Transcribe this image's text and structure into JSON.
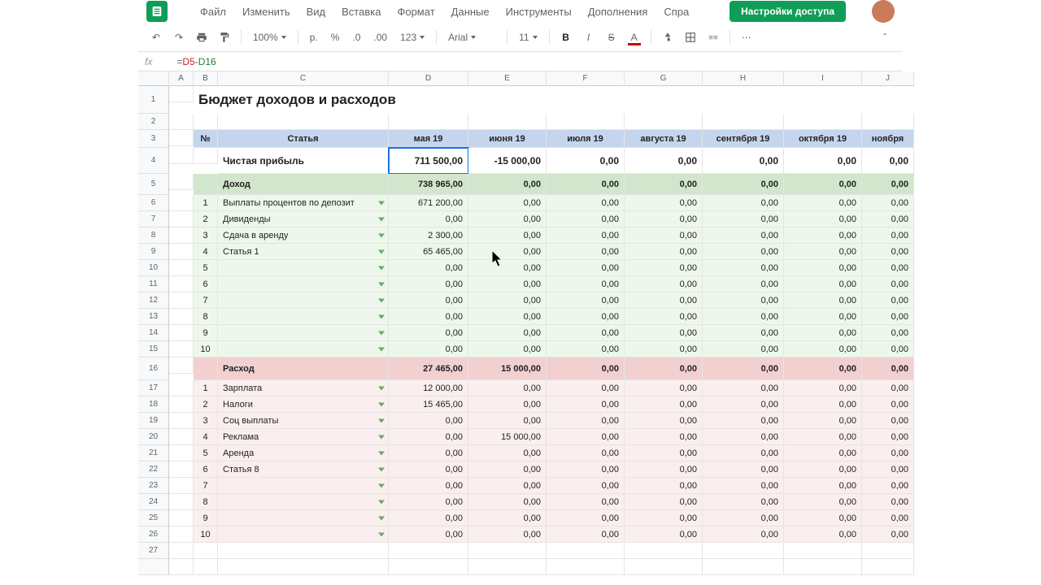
{
  "menubar": {
    "items": [
      "Файл",
      "Изменить",
      "Вид",
      "Вставка",
      "Формат",
      "Данные",
      "Инструменты",
      "Дополнения",
      "Спра"
    ],
    "share": "Настройки доступа"
  },
  "toolbar": {
    "zoom": "100%",
    "currency": "р.",
    "pct": "%",
    "dec_minus": ".0",
    "dec_plus": ".00",
    "format": "123",
    "font": "Arial",
    "font_size": "11"
  },
  "formula": {
    "fx": "fx",
    "eq": "=",
    "ref1": "D5",
    "minus": "-",
    "ref2": "D16"
  },
  "columns": [
    "",
    "A",
    "B",
    "C",
    "D",
    "E",
    "F",
    "G",
    "H",
    "I",
    "J"
  ],
  "title": "Бюджет доходов и расходов",
  "header": {
    "num": "№",
    "article": "Статья",
    "months": [
      "мая 19",
      "июня 19",
      "июля 19",
      "августа 19",
      "сентября 19",
      "октября 19",
      "ноября"
    ]
  },
  "profit": {
    "label": "Чистая прибыль",
    "values": [
      "711 500,00",
      "-15 000,00",
      "0,00",
      "0,00",
      "0,00",
      "0,00",
      "0,00"
    ]
  },
  "income": {
    "label": "Доход",
    "totals": [
      "738 965,00",
      "0,00",
      "0,00",
      "0,00",
      "0,00",
      "0,00",
      "0,00"
    ],
    "rows": [
      {
        "n": "1",
        "label": "Выплаты процентов по депозит",
        "vals": [
          "671 200,00",
          "0,00",
          "0,00",
          "0,00",
          "0,00",
          "0,00",
          "0,00"
        ]
      },
      {
        "n": "2",
        "label": "Дивиденды",
        "vals": [
          "0,00",
          "0,00",
          "0,00",
          "0,00",
          "0,00",
          "0,00",
          "0,00"
        ]
      },
      {
        "n": "3",
        "label": "Сдача в аренду",
        "vals": [
          "2 300,00",
          "0,00",
          "0,00",
          "0,00",
          "0,00",
          "0,00",
          "0,00"
        ]
      },
      {
        "n": "4",
        "label": "Статья 1",
        "vals": [
          "65 465,00",
          "0,00",
          "0,00",
          "0,00",
          "0,00",
          "0,00",
          "0,00"
        ]
      },
      {
        "n": "5",
        "label": "",
        "vals": [
          "0,00",
          "0,00",
          "0,00",
          "0,00",
          "0,00",
          "0,00",
          "0,00"
        ]
      },
      {
        "n": "6",
        "label": "",
        "vals": [
          "0,00",
          "0,00",
          "0,00",
          "0,00",
          "0,00",
          "0,00",
          "0,00"
        ]
      },
      {
        "n": "7",
        "label": "",
        "vals": [
          "0,00",
          "0,00",
          "0,00",
          "0,00",
          "0,00",
          "0,00",
          "0,00"
        ]
      },
      {
        "n": "8",
        "label": "",
        "vals": [
          "0,00",
          "0,00",
          "0,00",
          "0,00",
          "0,00",
          "0,00",
          "0,00"
        ]
      },
      {
        "n": "9",
        "label": "",
        "vals": [
          "0,00",
          "0,00",
          "0,00",
          "0,00",
          "0,00",
          "0,00",
          "0,00"
        ]
      },
      {
        "n": "10",
        "label": "",
        "vals": [
          "0,00",
          "0,00",
          "0,00",
          "0,00",
          "0,00",
          "0,00",
          "0,00"
        ]
      }
    ]
  },
  "expense": {
    "label": "Расход",
    "totals": [
      "27 465,00",
      "15 000,00",
      "0,00",
      "0,00",
      "0,00",
      "0,00",
      "0,00"
    ],
    "rows": [
      {
        "n": "1",
        "label": "Зарплата",
        "vals": [
          "12 000,00",
          "0,00",
          "0,00",
          "0,00",
          "0,00",
          "0,00",
          "0,00"
        ]
      },
      {
        "n": "2",
        "label": "Налоги",
        "vals": [
          "15 465,00",
          "0,00",
          "0,00",
          "0,00",
          "0,00",
          "0,00",
          "0,00"
        ]
      },
      {
        "n": "3",
        "label": "Соц выплаты",
        "vals": [
          "0,00",
          "0,00",
          "0,00",
          "0,00",
          "0,00",
          "0,00",
          "0,00"
        ]
      },
      {
        "n": "4",
        "label": "Реклама",
        "vals": [
          "0,00",
          "15 000,00",
          "0,00",
          "0,00",
          "0,00",
          "0,00",
          "0,00"
        ]
      },
      {
        "n": "5",
        "label": "Аренда",
        "vals": [
          "0,00",
          "0,00",
          "0,00",
          "0,00",
          "0,00",
          "0,00",
          "0,00"
        ]
      },
      {
        "n": "6",
        "label": "Статья 8",
        "vals": [
          "0,00",
          "0,00",
          "0,00",
          "0,00",
          "0,00",
          "0,00",
          "0,00"
        ]
      },
      {
        "n": "7",
        "label": "",
        "vals": [
          "0,00",
          "0,00",
          "0,00",
          "0,00",
          "0,00",
          "0,00",
          "0,00"
        ]
      },
      {
        "n": "8",
        "label": "",
        "vals": [
          "0,00",
          "0,00",
          "0,00",
          "0,00",
          "0,00",
          "0,00",
          "0,00"
        ]
      },
      {
        "n": "9",
        "label": "",
        "vals": [
          "0,00",
          "0,00",
          "0,00",
          "0,00",
          "0,00",
          "0,00",
          "0,00"
        ]
      },
      {
        "n": "10",
        "label": "",
        "vals": [
          "0,00",
          "0,00",
          "0,00",
          "0,00",
          "0,00",
          "0,00",
          "0,00"
        ]
      }
    ]
  },
  "row_numbers": [
    "1",
    "2",
    "3",
    "4",
    "5",
    "6",
    "7",
    "8",
    "9",
    "10",
    "11",
    "12",
    "13",
    "14",
    "15",
    "16",
    "17",
    "18",
    "19",
    "20",
    "21",
    "22",
    "23",
    "24",
    "25",
    "26",
    "27",
    ""
  ],
  "chart_data": {
    "type": "table",
    "title": "Бюджет доходов и расходов",
    "months": [
      "мая 19",
      "июня 19",
      "июля 19",
      "августа 19",
      "сентября 19",
      "октября 19"
    ],
    "net_profit": [
      711500,
      -15000,
      0,
      0,
      0,
      0
    ],
    "income_total": [
      738965,
      0,
      0,
      0,
      0,
      0
    ],
    "income_items": {
      "Выплаты процентов по депозиту": [
        671200,
        0,
        0,
        0,
        0,
        0
      ],
      "Дивиденды": [
        0,
        0,
        0,
        0,
        0,
        0
      ],
      "Сдача в аренду": [
        2300,
        0,
        0,
        0,
        0,
        0
      ],
      "Статья 1": [
        65465,
        0,
        0,
        0,
        0,
        0
      ]
    },
    "expense_total": [
      27465,
      15000,
      0,
      0,
      0,
      0
    ],
    "expense_items": {
      "Зарплата": [
        12000,
        0,
        0,
        0,
        0,
        0
      ],
      "Налоги": [
        15465,
        0,
        0,
        0,
        0,
        0
      ],
      "Соц выплаты": [
        0,
        0,
        0,
        0,
        0,
        0
      ],
      "Реклама": [
        0,
        15000,
        0,
        0,
        0,
        0
      ],
      "Аренда": [
        0,
        0,
        0,
        0,
        0,
        0
      ],
      "Статья 8": [
        0,
        0,
        0,
        0,
        0,
        0
      ]
    }
  }
}
